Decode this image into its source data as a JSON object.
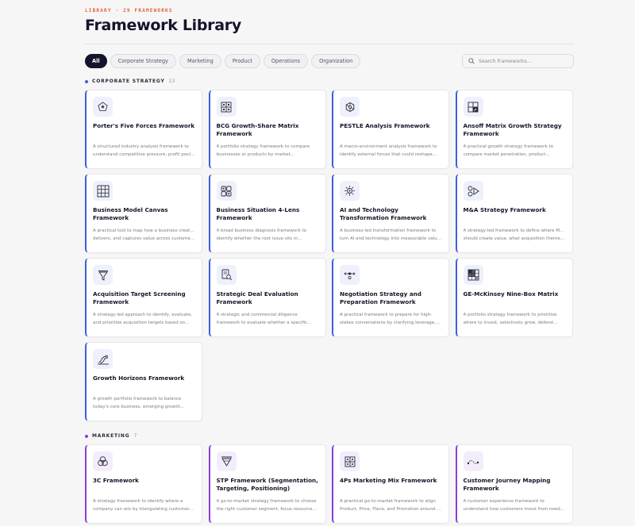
{
  "header": {
    "eyebrow": "LIBRARY · 29 FRAMEWORKS",
    "title": "Framework Library"
  },
  "filters": [
    "All",
    "Corporate Strategy",
    "Marketing",
    "Product",
    "Operations",
    "Organization"
  ],
  "active_filter": "All",
  "search": {
    "placeholder": "Search frameworks..."
  },
  "colors": {
    "corporate": "#3f5fdc",
    "marketing": "#8a3fd6",
    "accent": "#e0613a"
  },
  "sections": [
    {
      "title": "CORPORATE STRATEGY",
      "count": "13",
      "cards": [
        {
          "icon": "pentagon-star-icon",
          "name": "Porter's Five Forces Framework",
          "desc1": "A structured industry analysis framework to",
          "desc2": "understand competitive pressure, profit pools..."
        },
        {
          "icon": "matrix-grid-icon",
          "name": "BCG Growth-Share Matrix Framework",
          "desc1": "A portfolio strategy framework to compare",
          "desc2": "businesses or products by market..."
        },
        {
          "icon": "network-hex-icon",
          "name": "PESTLE Analysis Framework",
          "desc1": "A macro-environment analysis framework to",
          "desc2": "identify external forces that could reshape..."
        },
        {
          "icon": "ansoff-matrix-icon",
          "name": "Ansoff Matrix Growth Strategy Framework",
          "desc1": "A practical growth strategy framework to",
          "desc2": "compare market penetration, product..."
        },
        {
          "icon": "canvas-grid-icon",
          "name": "Business Model Canvas Framework",
          "desc1": "A practical tool to map how a business creates,",
          "desc2": "delivers, and captures value across customers,..."
        },
        {
          "icon": "four-lens-icon",
          "name": "Business Situation 4-Lens Framework",
          "desc1": "A broad business diagnosis framework to",
          "desc2": "identify whether the root issue sits in..."
        },
        {
          "icon": "ai-chip-icon",
          "name": "AI and Technology Transformation Framework",
          "desc1": "A business-led transformation framework to",
          "desc2": "turn AI and technology into measurable value..."
        },
        {
          "icon": "merge-arrow-icon",
          "name": "M&A Strategy Framework",
          "desc1": "A strategy-led framework to define where M&A",
          "desc2": "should create value, what acquisition themes t..."
        },
        {
          "icon": "funnel-icon",
          "name": "Acquisition Target Screening Framework",
          "desc1": "A strategy-led approach to identify, evaluate,",
          "desc2": "and prioritize acquisition targets based on..."
        },
        {
          "icon": "document-search-icon",
          "name": "Strategic Deal Evaluation Framework",
          "desc1": "A strategic and commercial diligence",
          "desc2": "framework to evaluate whether a specific..."
        },
        {
          "icon": "negotiation-icon",
          "name": "Negotiation Strategy and Preparation Framework",
          "desc1": "A practical framework to prepare for high-",
          "desc2": "stakes conversations by clarifying leverage,..."
        },
        {
          "icon": "nine-box-icon",
          "name": "GE-McKinsey Nine-Box Matrix",
          "desc1": "A portfolio strategy framework to prioritize",
          "desc2": "where to invest, selectively grow, defend..."
        },
        {
          "icon": "growth-curve-icon",
          "name": "Growth Horizons Framework",
          "desc1": "A growth portfolio framework to balance",
          "desc2": "today's core business, emerging growth..."
        }
      ]
    },
    {
      "title": "MARKETING",
      "count": "7",
      "cards": [
        {
          "icon": "three-circles-icon",
          "name": "3C Framework",
          "desc1": "A strategy framework to identify where a",
          "desc2": "company can win by triangulating customer..."
        },
        {
          "icon": "target-funnel-icon",
          "name": "STP Framework (Segmentation, Targeting, Positioning)",
          "desc1": "A go-to-market strategy framework to choose",
          "desc2": "the right customer segment, focus resources,..."
        },
        {
          "icon": "four-p-grid-icon",
          "name": "4Ps Marketing Mix Framework",
          "desc1": "A practical go-to-market framework to align",
          "desc2": "Product, Price, Place, and Promotion around a..."
        },
        {
          "icon": "journey-path-icon",
          "name": "Customer Journey Mapping Framework",
          "desc1": "A customer experience framework to",
          "desc2": "understand how customers move from need to..."
        }
      ]
    }
  ]
}
